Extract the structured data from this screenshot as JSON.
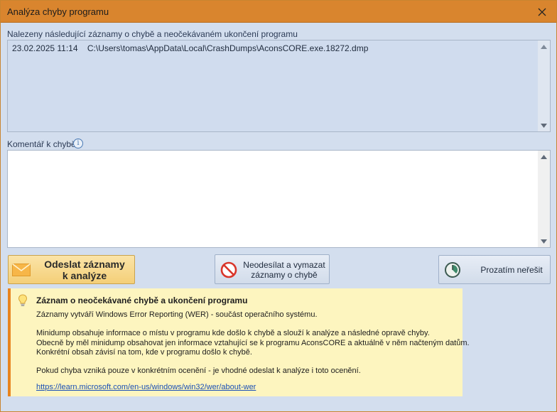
{
  "window": {
    "title": "Analýza chyby programu"
  },
  "reports": {
    "label": "Nalezeny následující záznamy o chybě a neočekávaném ukončení programu",
    "items": [
      {
        "text": "23.02.2025 11:14    C:\\Users\\tomas\\AppData\\Local\\CrashDumps\\AconsCORE.exe.18272.dmp"
      }
    ]
  },
  "comment": {
    "label": "Komentář k chybě",
    "value": ""
  },
  "buttons": {
    "send_line1": "Odeslat záznamy",
    "send_line2": "k analýze",
    "discard_line1": "Neodesílat a vymazat",
    "discard_line2": "záznamy o chybě",
    "later": "Prozatím neřešit"
  },
  "note": {
    "heading": "Záznam o neočekávané chybě a ukončení programu",
    "p1": "Záznamy vytváří Windows Error Reporting (WER) - součást operačního systému.",
    "p2": "Minidump obsahuje informace o místu v programu kde došlo k chybě a slouží k analýze a následné opravě chyby.",
    "p3": "Obecně by měl minidump obsahovat jen informace vztahující se k programu AconsCORE a aktuálně v něm načteným datům.",
    "p4": "Konkrétní obsah závisí na tom, kde v programu došlo k chybě.",
    "p5": "Pokud chyba vzniká pouze v konkrétním ocenění - je vhodné odeslat k analýze i toto ocenění.",
    "link": "https://learn.microsoft.com/en-us/windows/win32/wer/about-wer"
  },
  "icons": {
    "close": "close-icon",
    "info": "info-icon",
    "envelope": "envelope-icon",
    "no_entry": "no-entry-icon",
    "clock": "clock-icon",
    "bulb": "lightbulb-icon"
  },
  "colors": {
    "titlebar": "#d9852e",
    "accent": "#e8841e",
    "note_bg": "#fdf5bf",
    "link": "#1a4fb5"
  }
}
